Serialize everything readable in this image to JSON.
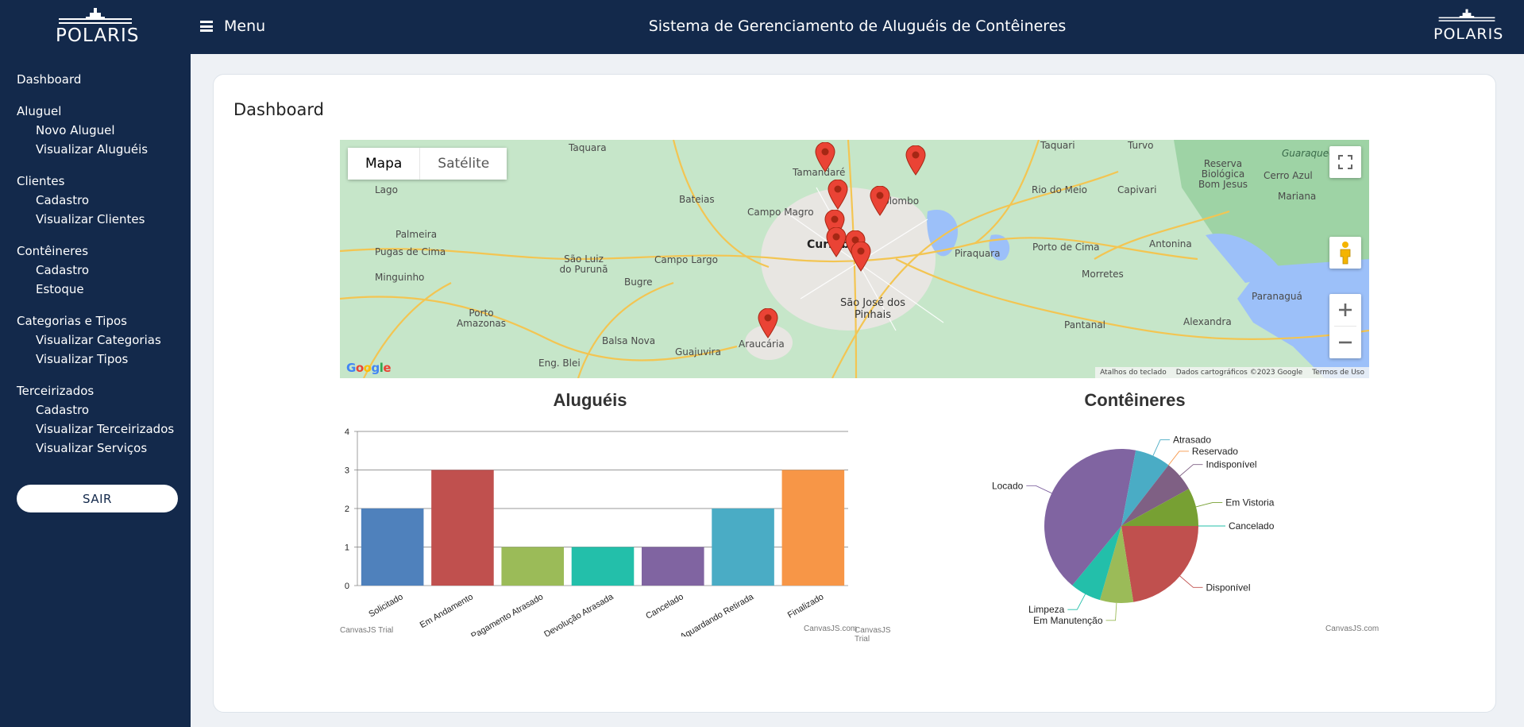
{
  "sidebar": {
    "logo_text": "POLARIS",
    "nav_top": "Dashboard",
    "groups": [
      {
        "title": "Aluguel",
        "items": [
          "Novo Aluguel",
          "Visualizar Aluguéis"
        ]
      },
      {
        "title": "Clientes",
        "items": [
          "Cadastro",
          "Visualizar Clientes"
        ]
      },
      {
        "title": "Contêineres",
        "items": [
          "Cadastro",
          "Estoque"
        ]
      },
      {
        "title": "Categorias e Tipos",
        "items": [
          "Visualizar Categorias",
          "Visualizar Tipos"
        ]
      },
      {
        "title": "Terceirizados",
        "items": [
          "Cadastro",
          "Visualizar Terceirizados",
          "Visualizar Serviços"
        ]
      }
    ],
    "logout_label": "SAIR"
  },
  "header": {
    "menu_label": "Menu",
    "app_title": "Sistema de Gerenciamento de Aluguéis de Contêineres",
    "logo_text": "POLARIS"
  },
  "main": {
    "page_title": "Dashboard"
  },
  "map": {
    "type_buttons": [
      "Mapa",
      "Satélite"
    ],
    "active_type": "Mapa",
    "google_logo": "Google",
    "footer": [
      "Atalhos do teclado",
      "Dados cartográficos ©2023 Google",
      "Termos de Uso"
    ],
    "labels": [
      {
        "text": "Taquara",
        "kind": "normal"
      },
      {
        "text": "Tamandaré",
        "kind": "normal"
      },
      {
        "text": "Taquari",
        "kind": "normal"
      },
      {
        "text": "Turvo",
        "kind": "normal"
      },
      {
        "text": "Lago",
        "kind": "normal"
      },
      {
        "text": "Bateias",
        "kind": "normal"
      },
      {
        "text": "Campo Magro",
        "kind": "normal"
      },
      {
        "text": "Colombo",
        "kind": "normal"
      },
      {
        "text": "Rio do Meio",
        "kind": "normal"
      },
      {
        "text": "Capivari",
        "kind": "normal"
      },
      {
        "text": "Cerro Azul",
        "kind": "normal"
      },
      {
        "text": "Palmeira",
        "kind": "normal"
      },
      {
        "text": "Pugas de Cima",
        "kind": "normal"
      },
      {
        "text": "São Luiz do Purunã",
        "kind": "normal"
      },
      {
        "text": "Campo Largo",
        "kind": "normal"
      },
      {
        "text": "Curitiba",
        "kind": "city"
      },
      {
        "text": "Piraquara",
        "kind": "normal"
      },
      {
        "text": "Porto de Cima",
        "kind": "normal"
      },
      {
        "text": "Antonina",
        "kind": "normal"
      },
      {
        "text": "Minguinho",
        "kind": "normal"
      },
      {
        "text": "Bugre",
        "kind": "normal"
      },
      {
        "text": "Morretes",
        "kind": "normal"
      },
      {
        "text": "Porto Amazonas",
        "kind": "normal"
      },
      {
        "text": "São José dos Pinhais",
        "kind": "mid"
      },
      {
        "text": "Pantanal",
        "kind": "normal"
      },
      {
        "text": "Alexandra",
        "kind": "normal"
      },
      {
        "text": "Balsa Nova",
        "kind": "normal"
      },
      {
        "text": "Araucária",
        "kind": "normal"
      },
      {
        "text": "Guajuvira",
        "kind": "normal"
      },
      {
        "text": "Eng. Blei",
        "kind": "normal"
      },
      {
        "text": "Paranaguá",
        "kind": "normal"
      },
      {
        "text": "Mariana",
        "kind": "normal"
      },
      {
        "text": "Reserva Biológica Bom Jesus",
        "kind": "normal"
      },
      {
        "text": "Guaraqueçaba",
        "kind": "normal"
      }
    ]
  },
  "chart_data": [
    {
      "type": "bar",
      "title": "Aluguéis",
      "categories": [
        "Solicitado",
        "Em Andamento",
        "Pagamento Atrasado",
        "Devolução Atrasada",
        "Cancelado",
        "Aguardando Retirada",
        "Finalizado"
      ],
      "values": [
        2,
        3,
        1,
        1,
        1,
        2,
        3
      ],
      "colors": [
        "#4f81bc",
        "#c0504e",
        "#9bbb58",
        "#23bfaa",
        "#8064a1",
        "#4aacc5",
        "#f79647"
      ],
      "ylim": [
        0,
        4
      ],
      "yticks": [
        0,
        1,
        2,
        3,
        4
      ],
      "grid": true,
      "credits": [
        "CanvasJS Trial",
        "CanvasJS.com",
        "CanvasJS Trial"
      ]
    },
    {
      "type": "pie",
      "title": "Contêineres",
      "slices": [
        {
          "label": "Cancelado",
          "value": 0,
          "color": "#23bfaa"
        },
        {
          "label": "Disponível",
          "value": 22.5,
          "color": "#c0504e"
        },
        {
          "label": "Em Manutenção",
          "value": 7,
          "color": "#9bbb58"
        },
        {
          "label": "Limpeza",
          "value": 6.5,
          "color": "#23bfaa"
        },
        {
          "label": "Locado",
          "value": 42,
          "color": "#8064a1"
        },
        {
          "label": "Atrasado",
          "value": 7.5,
          "color": "#4aacc5"
        },
        {
          "label": "Reservado",
          "value": 0,
          "color": "#f79647"
        },
        {
          "label": "Indisponível",
          "value": 6.5,
          "color": "#7f6084"
        },
        {
          "label": "Em Vistoria",
          "value": 8,
          "color": "#77a033"
        }
      ],
      "credits": [
        "CanvasJS.com"
      ]
    }
  ]
}
